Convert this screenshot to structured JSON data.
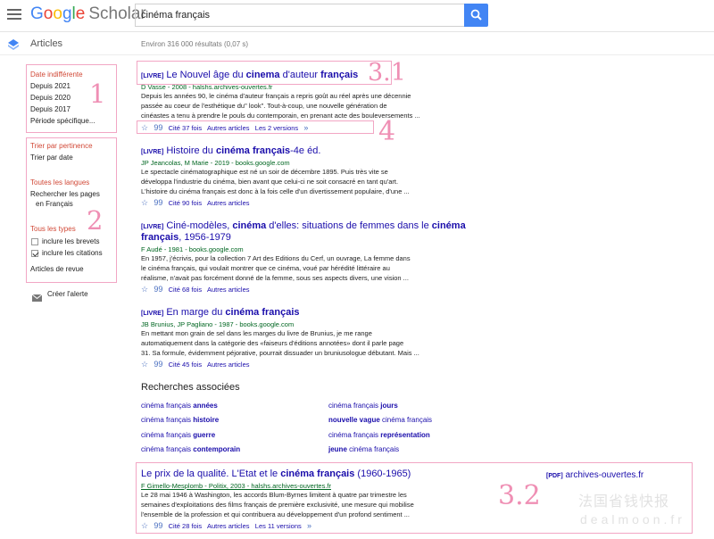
{
  "header": {
    "logo_google": "Google",
    "logo_scholar": "Scholar",
    "search_value": "cinéma français"
  },
  "articles_bar": {
    "title": "Articles",
    "stats": "Environ 316 000 résultats (0,07 s)"
  },
  "sidebar": {
    "date_options": [
      "Date indifférente",
      "Depuis 2021",
      "Depuis 2020",
      "Depuis 2017",
      "Période spécifique..."
    ],
    "sort_options": [
      "Trier par pertinence",
      "Trier par date"
    ],
    "language_options": [
      "Toutes les langues",
      "Rechercher les pages",
      "en Français"
    ],
    "type_options": [
      "Tous les types",
      "inclure les brevets",
      "inclure les citations",
      "Articles de revue"
    ],
    "alert_label": "Créer l'alerte"
  },
  "results": [
    {
      "tag": "[LIVRE]",
      "title_parts": [
        "Le Nouvel âge du ",
        "cinema",
        " d'auteur ",
        "français"
      ],
      "source": "D Vasse - 2008 - halshs.archives-ouvertes.fr",
      "snippet": [
        "Depuis les années 90, le cinéma d'auteur français a repris goût au réel après une décennie",
        "passée au coeur de l'esthétique du\" look\". Tout-à-coup, une nouvelle génération de",
        "cinéastes a tenu à prendre le pouls du contemporain, en prenant acte des bouleversements ..."
      ],
      "cited": "Cité 37 fois",
      "related": "Autres articles",
      "versions": "Les 2 versions"
    },
    {
      "tag": "[LIVRE]",
      "title_parts": [
        "Histoire du ",
        "cinéma français",
        "-4e éd."
      ],
      "source": "JP Jeancolas, M Marie - 2019 - books.google.com",
      "snippet": [
        "Le spectacle cinématographique est né un soir de décembre 1895. Puis très vite se",
        "développa l'industrie du cinéma, bien avant que celui-ci ne soit consacré en tant qu'art.",
        "L'histoire du cinéma français est donc à la fois celle d'un divertissement populaire, d'une ..."
      ],
      "cited": "Cité 90 fois",
      "related": "Autres articles"
    },
    {
      "tag": "[LIVRE]",
      "title_line1": [
        "Ciné-modèles, ",
        "cinéma",
        " d'elles: situations de femmes dans le ",
        "cinéma"
      ],
      "title_line2": [
        "français",
        ", 1956-1979"
      ],
      "source": "F Audé - 1981 - books.google.com",
      "snippet": [
        "En 1957, j'écrivis, pour la collection 7 Art des Editions du Cerf, un ouvrage, La femme dans",
        "le cinéma français, qui voulait montrer que ce cinéma, voué par hérédité littéraire au",
        "réalisme, n'avait pas forcément donné de la femme, sous ses aspects divers, une vision ..."
      ],
      "cited": "Cité 68 fois",
      "related": "Autres articles"
    },
    {
      "tag": "[LIVRE]",
      "title_parts": [
        "En marge du ",
        "cinéma français"
      ],
      "source": "JB Brunius, JP Pagliano - 1987 - books.google.com",
      "snippet": [
        "En mettant mon grain de sel dans les marges du livre de Brunius, je me range",
        "automatiquement dans la catégorie des «faiseurs d'éditions annotées» dont il parle page",
        "31. Sa formule, évidemment péjorative, pourrait dissuader un bruniusologue débutant. Mais ..."
      ],
      "cited": "Cité 45 fois",
      "related": "Autres articles"
    },
    {
      "title_parts": [
        "Le prix de la qualité. L'Etat et le ",
        "cinéma français",
        " (1960-1965)"
      ],
      "pdf_tag": "[PDF]",
      "pdf_source": "archives-ouvertes.fr",
      "source": "F Gimello-Mesplomb - Politix, 2003 - halshs.archives-ouvertes.fr",
      "snippet": [
        "Le 28 mai 1946 à Washington, les accords Blum-Byrnes limitent à quatre par trimestre les",
        "semaines d'exploitations des films français de première exclusivité, une mesure qui mobilise",
        "l'ensemble de la profession et qui contribuera au développement d'un profond sentiment ..."
      ],
      "cited": "Cité 28 fois",
      "related": "Autres articles",
      "versions": "Les 11 versions"
    }
  ],
  "related_searches": {
    "heading": "Recherches associées",
    "left": [
      [
        "cinéma français ",
        "années"
      ],
      [
        "cinéma français ",
        "histoire"
      ],
      [
        "cinéma français ",
        "guerre"
      ],
      [
        "cinéma français ",
        "contemporain"
      ]
    ],
    "right": [
      [
        "cinéma français ",
        "jours"
      ],
      [
        "nouvelle vague",
        " cinéma français"
      ],
      [
        "cinéma français ",
        "représentation"
      ],
      [
        "jeune",
        " cinéma français"
      ]
    ]
  },
  "annotations": [
    "1",
    "2",
    "3.1",
    "4",
    "3.2"
  ],
  "watermark": [
    "法国省钱快报",
    "dealmoon.fr"
  ],
  "colors": {
    "link": "#1a0dab",
    "source_green": "#006621",
    "filter_red": "#d14836",
    "search_blue": "#4285f4",
    "annotation_pink": "#ef8fb4"
  }
}
